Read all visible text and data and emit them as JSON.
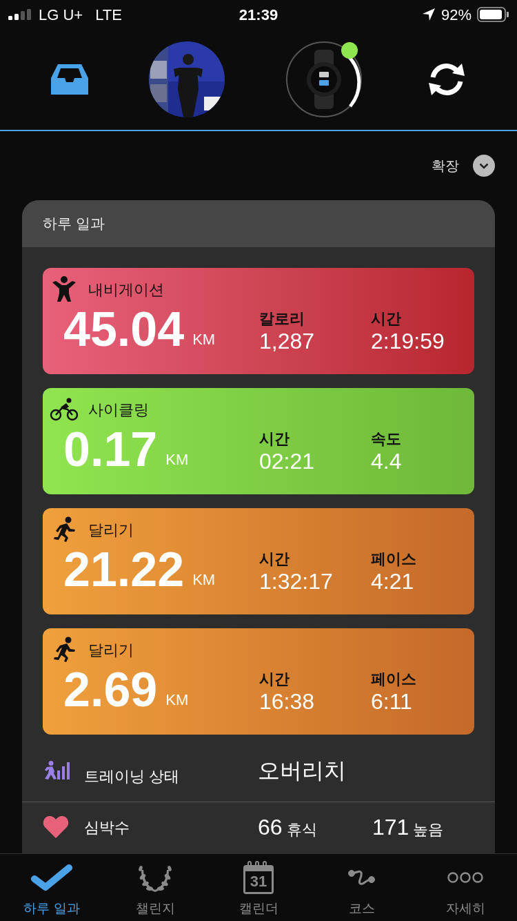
{
  "status_bar": {
    "carrier": "LG U+",
    "network": "LTE",
    "time": "21:39",
    "battery": "92%"
  },
  "header": {
    "expand_label": "확장"
  },
  "card": {
    "title": "하루 일과",
    "activities": [
      {
        "kind": "navigation",
        "name": "내비게이션",
        "distance": "45.04",
        "unit": "KM",
        "stats": [
          {
            "label": "칼로리",
            "value": "1,287"
          },
          {
            "label": "시간",
            "value": "2:19:59"
          }
        ]
      },
      {
        "kind": "cycling",
        "name": "사이클링",
        "distance": "0.17",
        "unit": "KM",
        "stats": [
          {
            "label": "시간",
            "value": "02:21"
          },
          {
            "label": "속도",
            "value": "4.4"
          }
        ]
      },
      {
        "kind": "running",
        "name": "달리기",
        "distance": "21.22",
        "unit": "KM",
        "stats": [
          {
            "label": "시간",
            "value": "1:32:17"
          },
          {
            "label": "페이스",
            "value": "4:21"
          }
        ]
      },
      {
        "kind": "running",
        "name": "달리기",
        "distance": "2.69",
        "unit": "KM",
        "stats": [
          {
            "label": "시간",
            "value": "16:38"
          },
          {
            "label": "페이스",
            "value": "6:11"
          }
        ]
      }
    ],
    "training": {
      "label": "트레이닝 상태",
      "value": "오버리치"
    },
    "heart_rate": {
      "label": "심박수",
      "resting": "66",
      "resting_label": "휴식",
      "high": "171",
      "high_label": "높음"
    }
  },
  "tabs": [
    {
      "kind": "check",
      "label": "하루 일과",
      "selected": true
    },
    {
      "kind": "laurel",
      "label": "챌린지",
      "selected": false
    },
    {
      "kind": "calendar",
      "label": "캘린더",
      "icon_text": "31",
      "selected": false
    },
    {
      "kind": "course",
      "label": "코스",
      "selected": false
    },
    {
      "kind": "more",
      "label": "자세히",
      "selected": false
    }
  ]
}
